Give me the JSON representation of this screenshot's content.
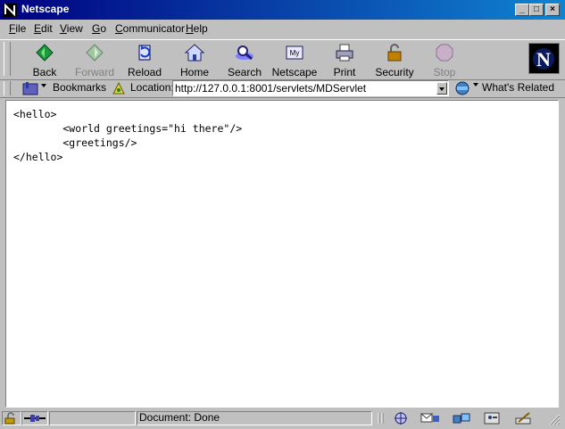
{
  "window": {
    "title": "Netscape"
  },
  "menu": [
    {
      "underline": "F",
      "rest": "ile"
    },
    {
      "underline": "E",
      "rest": "dit"
    },
    {
      "underline": "V",
      "rest": "iew"
    },
    {
      "underline": "G",
      "rest": "o"
    },
    {
      "underline": "C",
      "rest": "ommunicator"
    },
    {
      "underline": "H",
      "rest": "elp"
    }
  ],
  "toolbar": {
    "back": "Back",
    "forward": "Forward",
    "reload": "Reload",
    "home": "Home",
    "search": "Search",
    "netscape": "Netscape",
    "print": "Print",
    "security": "Security",
    "stop": "Stop"
  },
  "location": {
    "bookmarks": "Bookmarks",
    "label": "Location:",
    "url": "http://127.0.0.1:8001/servlets/MDServlet",
    "whats_related": "What's Related"
  },
  "content": {
    "lines": [
      "<hello>",
      "        <world greetings=\"hi there\"/>",
      "        <greetings/>",
      "</hello>"
    ]
  },
  "status": {
    "text": "Document: Done"
  },
  "colors": {
    "titlebar": "#000080",
    "chrome": "#c0c0c0",
    "link": "#0000ff"
  }
}
